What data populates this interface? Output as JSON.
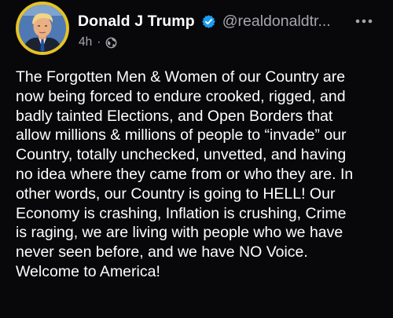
{
  "post": {
    "display_name": "Donald J Trump",
    "handle": "@realdonaldtr...",
    "timestamp": "4h",
    "separator": "·",
    "visibility_icon": "globe-icon",
    "verified_icon": "verified-badge-icon",
    "more_icon": "more-icon",
    "body_lines": [
      "The Forgotten Men & Women of our Country are",
      "now being forced to endure crooked, rigged, and",
      "badly tainted Elections, and Open Borders that",
      "allow millions & millions of people to “invade” our",
      "Country, totally unchecked, unvetted, and having",
      "no idea where they came from or who they are. In",
      "other words, our Country is going to HELL! Our",
      "Economy is crashing, Inflation is crushing, Crime",
      "is raging, we are living with people who we have",
      "never seen before, and we have NO Voice.",
      "Welcome to America!"
    ]
  },
  "colors": {
    "background": "#08080a",
    "text": "#ffffff",
    "secondary_text": "#a6a7ab",
    "verified": "#1d9bf0",
    "avatar_ring": "#e6c323"
  }
}
